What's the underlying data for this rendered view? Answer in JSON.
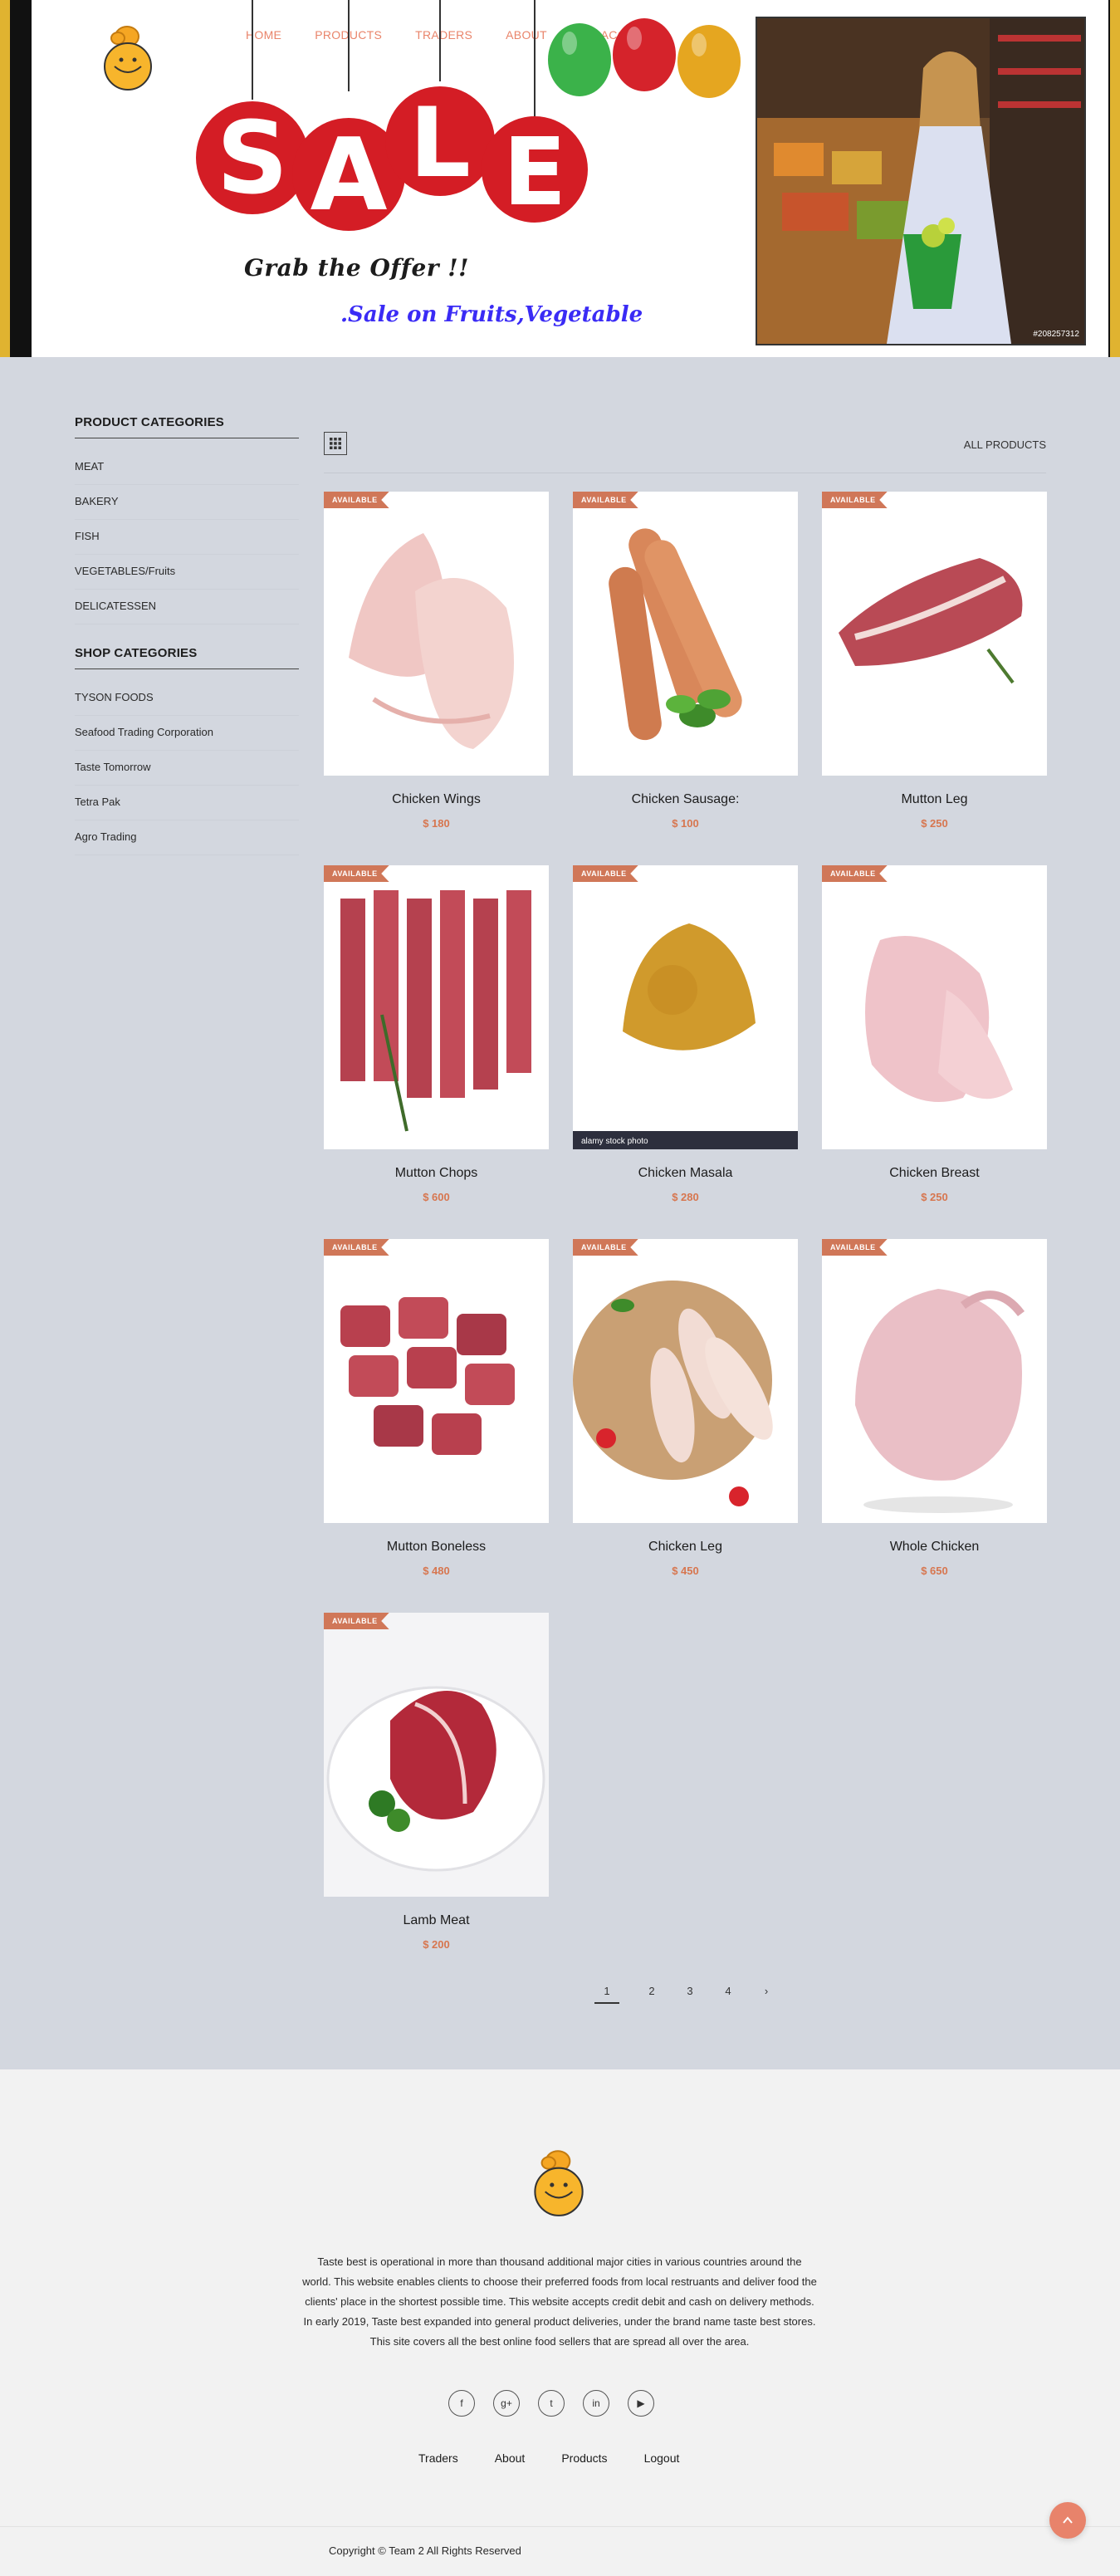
{
  "nav": {
    "items": [
      "HOME",
      "PRODUCTS",
      "TRADERS",
      "ABOUT",
      "MY ACCOUNT"
    ]
  },
  "hero": {
    "sale_letters": [
      "S",
      "A",
      "L",
      "E"
    ],
    "grab_text": "Grab the Offer !!",
    "sale_sub": ".Sale on Fruits,Vegetable",
    "photo_id": "#208257312"
  },
  "sidebar": {
    "product_heading": "PRODUCT CATEGORIES",
    "product_categories": [
      "MEAT",
      "BAKERY",
      "FISH",
      "VEGETABLES/Fruits",
      "DELICATESSEN"
    ],
    "shop_heading": "SHOP CATEGORIES",
    "shop_categories": [
      "TYSON FOODS",
      "Seafood Trading Corporation",
      "Taste Tomorrow",
      "Tetra Pak",
      "Agro Trading"
    ]
  },
  "toolbar": {
    "all_products": "ALL PRODUCTS",
    "grid_icon": "grid-view-icon"
  },
  "products": [
    {
      "name": "Chicken Wings",
      "price": "$ 180",
      "badge": "AVAILABLE"
    },
    {
      "name": "Chicken Sausage:",
      "price": "$ 100",
      "badge": "AVAILABLE"
    },
    {
      "name": "Mutton Leg",
      "price": "$ 250",
      "badge": "AVAILABLE"
    },
    {
      "name": "Mutton Chops",
      "price": "$ 600",
      "badge": "AVAILABLE"
    },
    {
      "name": "Chicken Masala",
      "price": "$ 280",
      "badge": "AVAILABLE"
    },
    {
      "name": "Chicken Breast",
      "price": "$ 250",
      "badge": "AVAILABLE"
    },
    {
      "name": "Mutton Boneless",
      "price": "$ 480",
      "badge": "AVAILABLE"
    },
    {
      "name": "Chicken Leg",
      "price": "$ 450",
      "badge": "AVAILABLE"
    },
    {
      "name": "Whole Chicken",
      "price": "$ 650",
      "badge": "AVAILABLE"
    },
    {
      "name": "Lamb Meat",
      "price": "$ 200",
      "badge": "AVAILABLE"
    }
  ],
  "stock_label": "alamy stock photo",
  "pagination": {
    "pages": [
      "1",
      "2",
      "3",
      "4",
      "›"
    ],
    "active": 0
  },
  "footer": {
    "description": "Taste best is operational in more than thousand additional major cities in various countries around the world. This website enables clients to choose their preferred foods from local restruants and deliver food the clients' place in the shortest possible time. This website accepts credit debit and cash on delivery methods. In early 2019, Taste best expanded into general product deliveries, under the brand name taste best stores. This site covers all the best online food sellers that are spread all over the area.",
    "socials": [
      "f",
      "g+",
      "t",
      "in",
      "▶"
    ],
    "links": [
      "Traders",
      "About",
      "Products",
      "Logout"
    ],
    "copyright": "Copyright © Team 2 All Rights Reserved"
  },
  "colors": {
    "accent": "#e9846a",
    "price": "#d7764f",
    "badge": "#d07758",
    "page_bg": "#d3d7df"
  }
}
